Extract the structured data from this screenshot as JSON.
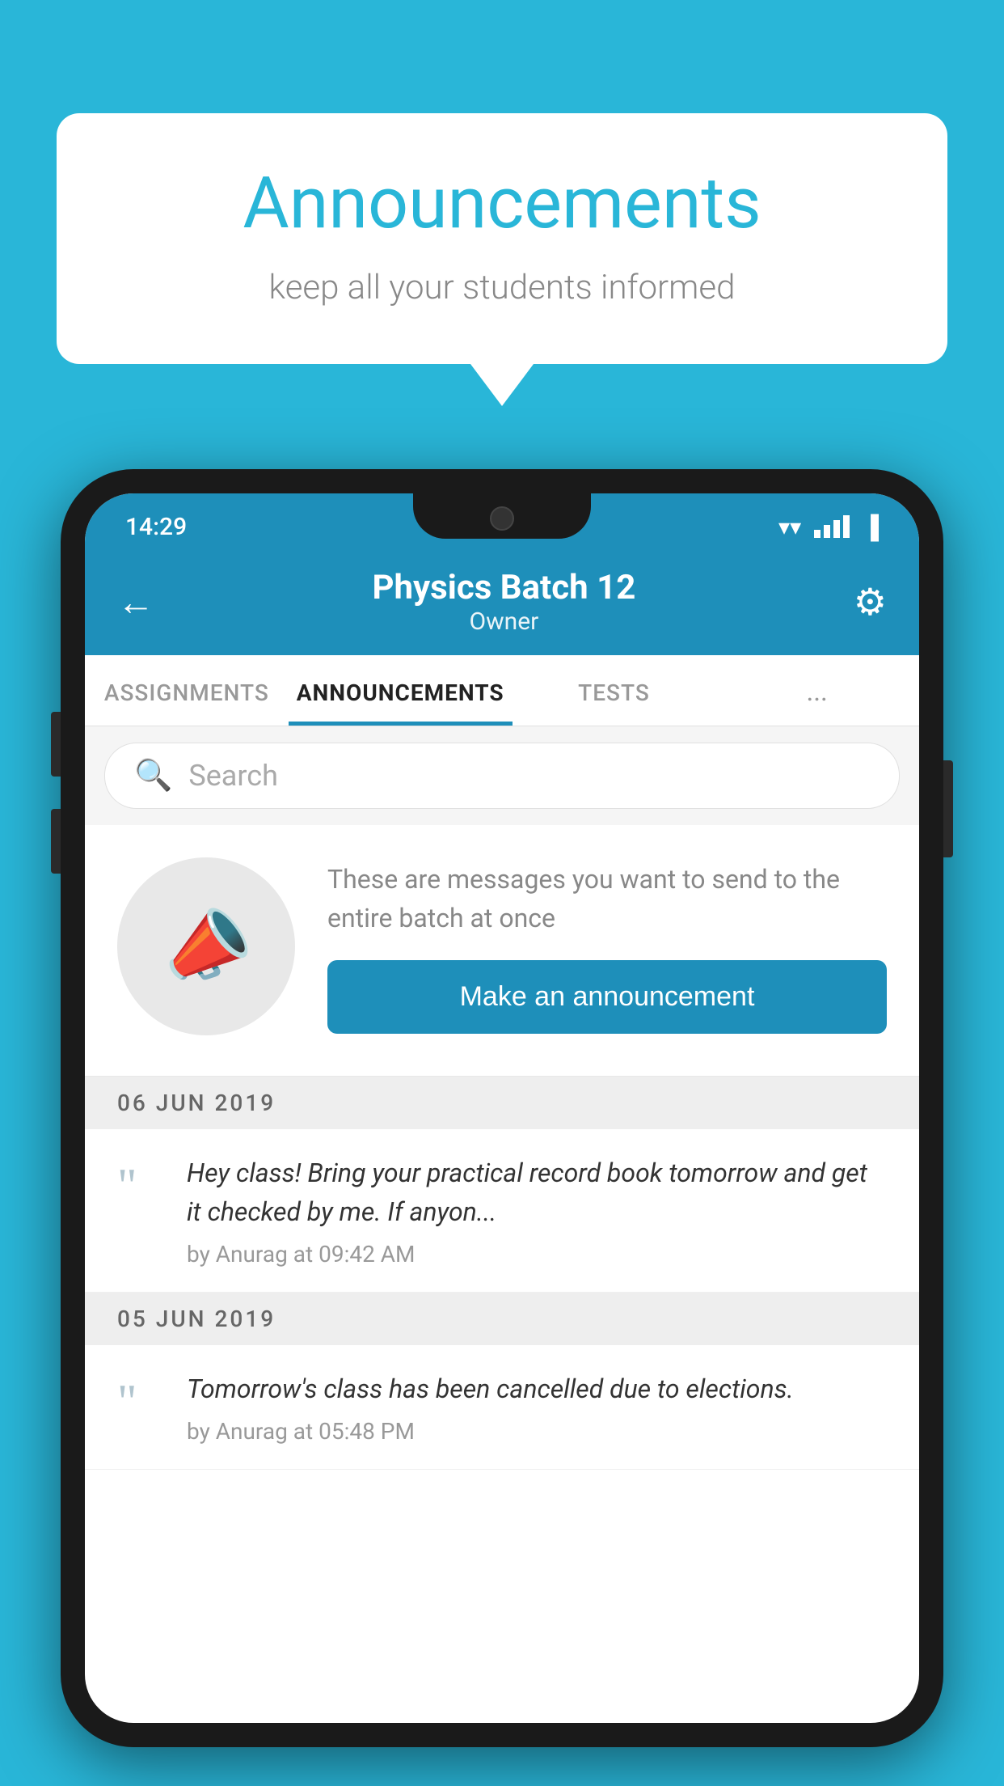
{
  "bubble": {
    "title": "Announcements",
    "subtitle": "keep all your students informed"
  },
  "status_bar": {
    "time": "14:29",
    "wifi": "▼",
    "battery": "▐"
  },
  "header": {
    "title": "Physics Batch 12",
    "subtitle": "Owner",
    "back_label": "←",
    "gear_label": "⚙"
  },
  "tabs": [
    {
      "label": "ASSIGNMENTS",
      "active": false
    },
    {
      "label": "ANNOUNCEMENTS",
      "active": true
    },
    {
      "label": "TESTS",
      "active": false
    },
    {
      "label": "...",
      "active": false
    }
  ],
  "search": {
    "placeholder": "Search"
  },
  "announcement_prompt": {
    "description": "These are messages you want to send to the entire batch at once",
    "button_label": "Make an announcement"
  },
  "dates": [
    {
      "label": "06  JUN  2019",
      "items": [
        {
          "text": "Hey class! Bring your practical record book tomorrow and get it checked by me. If anyon...",
          "meta": "by Anurag at 09:42 AM"
        }
      ]
    },
    {
      "label": "05  JUN  2019",
      "items": [
        {
          "text": "Tomorrow's class has been cancelled due to elections.",
          "meta": "by Anurag at 05:48 PM"
        }
      ]
    }
  ]
}
